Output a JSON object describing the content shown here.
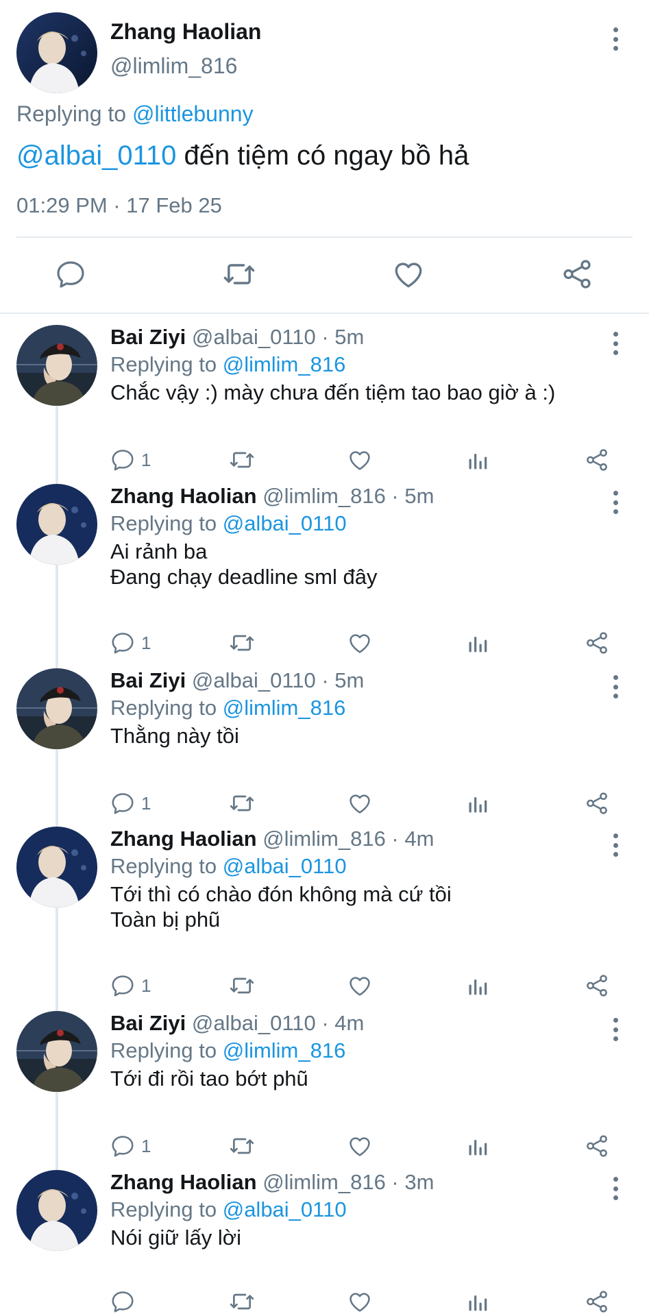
{
  "main_tweet": {
    "name": "Zhang Haolian",
    "handle": "@limlim_816",
    "replying_prefix": "Replying to ",
    "replying_handle": "@littlebunny",
    "text_mention": "@albai_0110",
    "text_body": " đến tiệm có ngay bồ hả",
    "timestamp": "01:29 PM · 17 Feb 25"
  },
  "replies": [
    {
      "name": "Bai Ziyi",
      "meta": " @albai_0110 · 5m",
      "replying_prefix": "Replying to ",
      "replying_handle": "@limlim_816",
      "lines": [
        "Chắc vậy :) mày chưa đến tiệm tao bao giờ à :)"
      ],
      "reply_count": "1"
    },
    {
      "name": "Zhang Haolian",
      "meta": " @limlim_816 · 5m",
      "replying_prefix": "Replying to ",
      "replying_handle": "@albai_0110",
      "lines": [
        "Ai rảnh ba",
        "Đang chạy deadline sml đây"
      ],
      "reply_count": "1"
    },
    {
      "name": "Bai Ziyi",
      "meta": " @albai_0110 · 5m",
      "replying_prefix": "Replying to ",
      "replying_handle": "@limlim_816",
      "lines": [
        "Thằng này tồi"
      ],
      "reply_count": "1"
    },
    {
      "name": "Zhang Haolian",
      "meta": " @limlim_816 · 4m",
      "replying_prefix": "Replying to ",
      "replying_handle": "@albai_0110",
      "lines": [
        "Tới thì có chào đón không mà cứ tồi",
        "Toàn bị phũ"
      ],
      "reply_count": "1"
    },
    {
      "name": "Bai Ziyi",
      "meta": " @albai_0110 · 4m",
      "replying_prefix": "Replying to ",
      "replying_handle": "@limlim_816",
      "lines": [
        "Tới đi rồi tao bớt phũ"
      ],
      "reply_count": "1"
    },
    {
      "name": "Zhang Haolian",
      "meta": " @limlim_816 · 3m",
      "replying_prefix": "Replying to ",
      "replying_handle": "@albai_0110",
      "lines": [
        "Nói giữ lấy lời"
      ],
      "reply_count": ""
    }
  ],
  "icons": {
    "reply": "reply-icon",
    "retweet": "retweet-icon",
    "like": "heart-icon",
    "analytics": "analytics-icon",
    "share": "share-icon",
    "more": "more-options-icon"
  },
  "colors": {
    "link": "#1b95e0",
    "secondary_text": "#657786",
    "primary_text": "#14171a",
    "divider": "#e6ecf0"
  }
}
